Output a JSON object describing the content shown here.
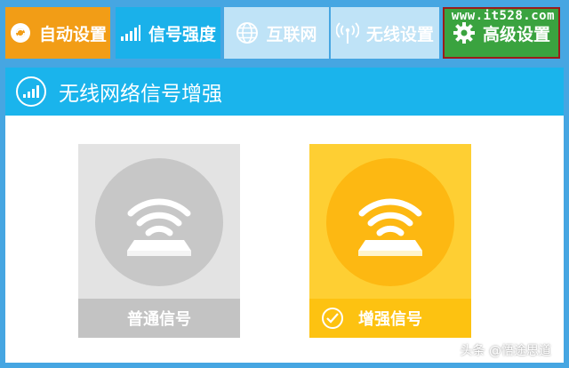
{
  "tabs": [
    {
      "label": "自动设置",
      "icon": "gear-refresh-icon",
      "color": "#f29d16"
    },
    {
      "label": "信号强度",
      "icon": "signal-bars-icon",
      "color": "#1ab1ea"
    },
    {
      "label": "互联网",
      "icon": "globe-icon",
      "color": "#bfe3f7"
    },
    {
      "label": "无线设置",
      "icon": "antenna-icon",
      "color": "#bfe3f7"
    },
    {
      "label": "高级设置",
      "icon": "gear-icon",
      "color": "#3aa33f"
    }
  ],
  "watermark": "www.it528.com",
  "panel": {
    "title": "无线网络信号增强",
    "icon": "signal-bars-icon",
    "header_color": "#1ab4ec"
  },
  "options": [
    {
      "label": "普通信号",
      "icon": "wifi-router-icon",
      "selected": false,
      "color": "#e3e3e3"
    },
    {
      "label": "增强信号",
      "icon": "wifi-router-icon",
      "selected": true,
      "color": "#fecf33"
    }
  ],
  "credit": "头条 @悟途思道"
}
